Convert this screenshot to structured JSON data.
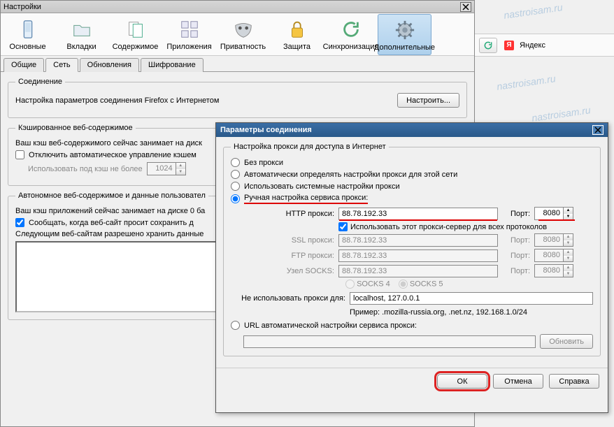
{
  "settings": {
    "title": "Настройки",
    "toolbar": [
      {
        "label": "Основные",
        "icon": "phone"
      },
      {
        "label": "Вкладки",
        "icon": "folder"
      },
      {
        "label": "Содержимое",
        "icon": "page"
      },
      {
        "label": "Приложения",
        "icon": "apps"
      },
      {
        "label": "Приватность",
        "icon": "mask"
      },
      {
        "label": "Защита",
        "icon": "lock"
      },
      {
        "label": "Синхронизация",
        "icon": "sync"
      },
      {
        "label": "Дополнительные",
        "icon": "gear"
      }
    ],
    "subtabs": [
      "Общие",
      "Сеть",
      "Обновления",
      "Шифрование"
    ],
    "connection": {
      "legend": "Соединение",
      "desc": "Настройка параметров соединения Firefox с Интернетом",
      "configure_btn": "Настроить..."
    },
    "cache": {
      "legend": "Кэшированное веб-содержимое",
      "desc_prefix": "Ваш кэш веб-содержимого сейчас занимает на диск",
      "disable_auto": "Отключить автоматическое управление кэшем",
      "use_under": "Использовать под кэш не более",
      "size_value": "1024"
    },
    "offline": {
      "legend": "Автономное веб-содержимое и данные пользовател",
      "desc_prefix": "Ваш кэш приложений сейчас занимает на диске 0 ба",
      "notify": "Сообщать, когда веб-сайт просит сохранить д",
      "sites_prefix": "Следующим веб-сайтам разрешено хранить данные"
    }
  },
  "conn_dialog": {
    "title": "Параметры соединения",
    "legend": "Настройка прокси для доступа в Интернет",
    "opt_no_proxy": "Без прокси",
    "opt_auto": "Автоматически определять настройки прокси для этой сети",
    "opt_system": "Использовать системные настройки прокси",
    "opt_manual": "Ручная настройка сервиса прокси:",
    "http_label": "HTTP прокси:",
    "http_value": "88.78.192.33",
    "port_label": "Порт:",
    "port_value": "8080",
    "use_for_all": "Использовать этот прокси-сервер для всех протоколов",
    "ssl_label": "SSL прокси:",
    "ftp_label": "FTP прокси:",
    "socks_label": "Узел SOCKS:",
    "disabled_host": "88.78.192.33",
    "disabled_port": "8080",
    "socks4": "SOCKS 4",
    "socks5": "SOCKS 5",
    "no_proxy_label": "Не использовать прокси для:",
    "no_proxy_value": "localhost, 127.0.0.1",
    "no_proxy_example": "Пример: .mozilla-russia.org, .net.nz, 192.168.1.0/24",
    "opt_url": "URL автоматической настройки сервиса прокси:",
    "reload_btn": "Обновить",
    "ok_btn": "ОК",
    "cancel_btn": "Отмена",
    "help_btn": "Справка"
  },
  "browser": {
    "search": "Яндекс"
  }
}
